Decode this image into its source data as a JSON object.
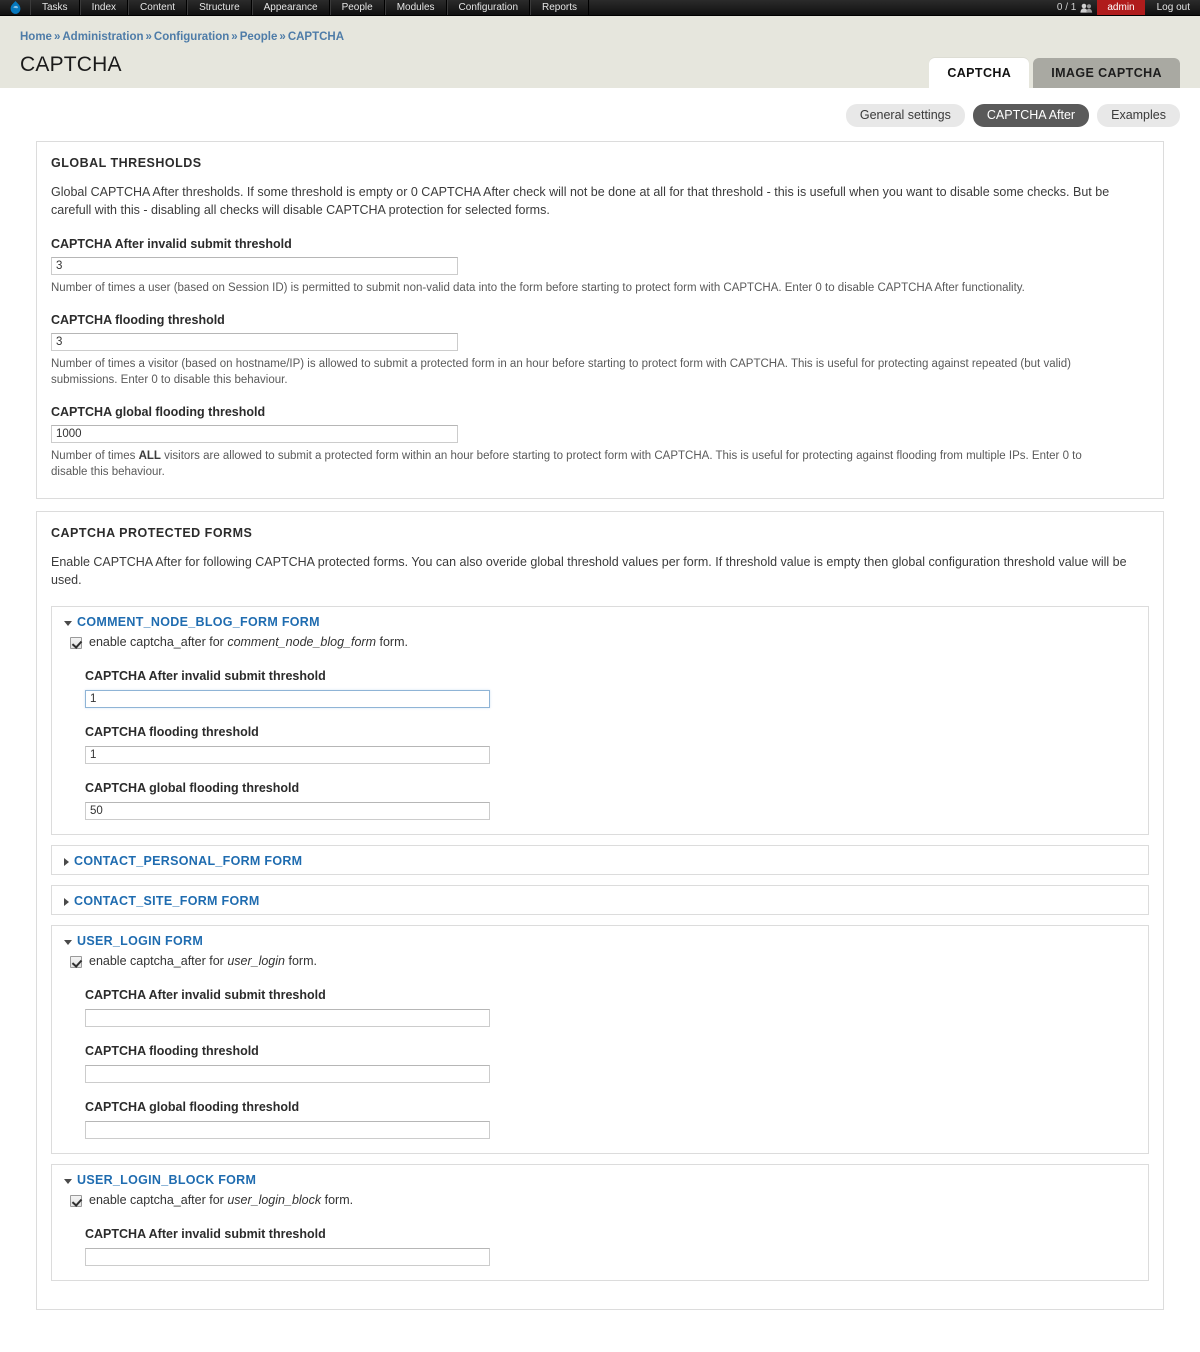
{
  "toolbar": {
    "logo_icon": "drupal-droplet-icon",
    "menu": [
      "Tasks",
      "Index",
      "Content",
      "Structure",
      "Appearance",
      "People",
      "Modules",
      "Configuration",
      "Reports"
    ],
    "user_count": "0 / 1",
    "people_icon": "people-icon",
    "user": "admin",
    "logout": "Log out"
  },
  "breadcrumb": {
    "separator": "»",
    "items": [
      "Home",
      "Administration",
      "Configuration",
      "People",
      "CAPTCHA"
    ]
  },
  "page": {
    "title": "CAPTCHA"
  },
  "primary_tabs": [
    {
      "label": "CAPTCHA",
      "active": true
    },
    {
      "label": "IMAGE CAPTCHA",
      "active": false
    }
  ],
  "secondary_tabs": [
    {
      "label": "General settings",
      "active": false
    },
    {
      "label": "CAPTCHA After",
      "active": true
    },
    {
      "label": "Examples",
      "active": false
    }
  ],
  "global_thresholds": {
    "title": "GLOBAL THRESHOLDS",
    "description": "Global CAPTCHA After thresholds. If some threshold is empty or 0 CAPTCHA After check will not be done at all for that threshold - this is usefull when you want to disable some checks. But be carefull with this - disabling all checks will disable CAPTCHA protection for selected forms.",
    "fields": [
      {
        "label": "CAPTCHA After invalid submit threshold",
        "value": "3",
        "description": "Number of times a user (based on Session ID) is permitted to submit non-valid data into the form before starting to protect form with CAPTCHA. Enter 0 to disable CAPTCHA After functionality."
      },
      {
        "label": "CAPTCHA flooding threshold",
        "value": "3",
        "description": "Number of times a visitor (based on hostname/IP) is allowed to submit a protected form in an hour before starting to protect form with CAPTCHA. This is useful for protecting against repeated (but valid) submissions. Enter 0 to disable this behaviour."
      },
      {
        "label": "CAPTCHA global flooding threshold",
        "value": "1000",
        "description_pre": "Number of times ",
        "description_bold": "ALL",
        "description_post": " visitors are allowed to submit a protected form within an hour before starting to protect form with CAPTCHA. This is useful for protecting against flooding from multiple IPs. Enter 0 to disable this behaviour."
      }
    ]
  },
  "protected_forms": {
    "title": "CAPTCHA PROTECTED FORMS",
    "description": "Enable CAPTCHA After for following CAPTCHA protected forms. You can also overide global threshold values per form. If threshold value is empty then global configuration threshold value will be used.",
    "field_labels": {
      "invalid_submit": "CAPTCHA After invalid submit threshold",
      "flooding": "CAPTCHA flooding threshold",
      "global_flooding": "CAPTCHA global flooding threshold"
    },
    "checkbox_prefix": "enable captcha_after for",
    "checkbox_suffix": "form.",
    "forms": [
      {
        "legend": "COMMENT_NODE_BLOG_FORM FORM",
        "expanded": true,
        "machine_name": "comment_node_blog_form",
        "checked": true,
        "focused_field": 0,
        "values": [
          "1",
          "1",
          "50"
        ]
      },
      {
        "legend": "CONTACT_PERSONAL_FORM FORM",
        "expanded": false
      },
      {
        "legend": "CONTACT_SITE_FORM FORM",
        "expanded": false
      },
      {
        "legend": "USER_LOGIN FORM",
        "expanded": true,
        "machine_name": "user_login",
        "checked": true,
        "focused_field": -1,
        "values": [
          "",
          "",
          ""
        ]
      },
      {
        "legend": "USER_LOGIN_BLOCK FORM",
        "expanded": true,
        "machine_name": "user_login_block",
        "checked": true,
        "focused_field": -1,
        "values": [
          "",
          "",
          ""
        ]
      }
    ]
  },
  "colors": {
    "toolbar_bg": "#1a1a1a",
    "user_badge": "#b01c1c",
    "header_bg": "#e6e6dd",
    "link_blue": "#1f6cb0",
    "breadcrumb_blue": "#4e7ca8",
    "active_pill": "#5a5a5a",
    "panel_border": "#dcdcdc"
  }
}
